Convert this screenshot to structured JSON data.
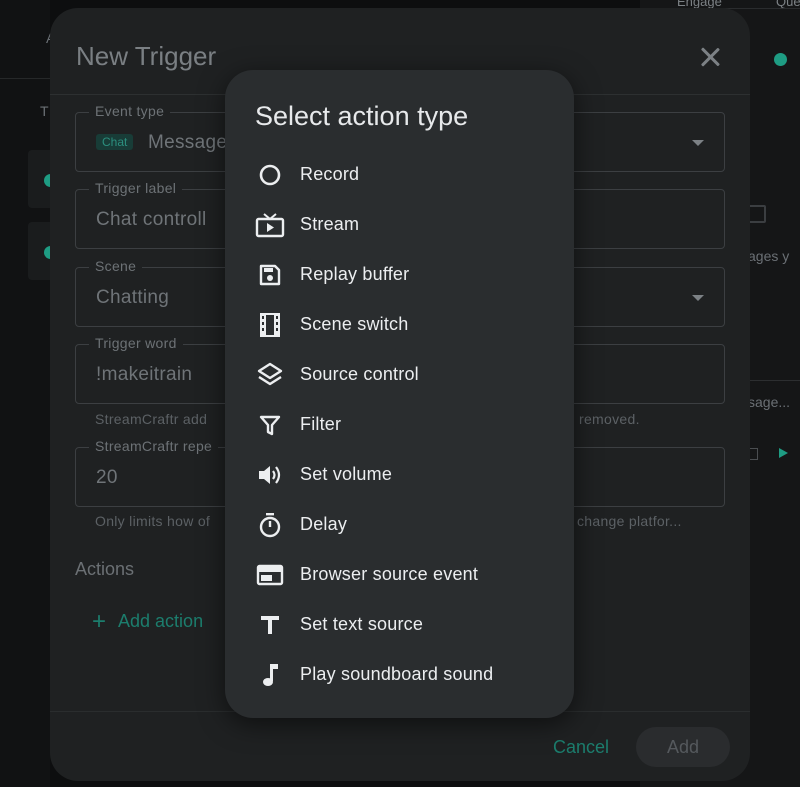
{
  "background": {
    "tabs": [
      "Engage",
      "Que"
    ],
    "left_fragments": [
      "A",
      "T"
    ],
    "right_fragments": [
      "ages y",
      "sage..."
    ]
  },
  "dialog": {
    "title": "New Trigger",
    "fields": {
      "event_type": {
        "label": "Event type",
        "chip": "Chat",
        "value": "Message"
      },
      "trigger_label": {
        "label": "Trigger label",
        "value": "Chat controll"
      },
      "scene": {
        "label": "Scene",
        "value": "Chatting"
      },
      "trigger_word": {
        "label": "Trigger word",
        "value": "!makeitrain"
      },
      "repeat": {
        "label": "StreamCraftr repe",
        "value": "20"
      }
    },
    "helper_trigger_word_left": "StreamCraftr add",
    "helper_trigger_word_right": "removed.",
    "helper_repeat_left": "Only limits how of",
    "helper_repeat_right": "change platfor...",
    "actions_heading": "Actions",
    "add_action_label": "Add action",
    "cancel_label": "Cancel",
    "add_label": "Add"
  },
  "popup": {
    "title": "Select action type",
    "items": [
      {
        "label": "Record",
        "icon": "record-icon"
      },
      {
        "label": "Stream",
        "icon": "tv-play-icon"
      },
      {
        "label": "Replay buffer",
        "icon": "save-icon"
      },
      {
        "label": "Scene switch",
        "icon": "film-icon"
      },
      {
        "label": "Source control",
        "icon": "layers-icon"
      },
      {
        "label": "Filter",
        "icon": "funnel-icon"
      },
      {
        "label": "Set volume",
        "icon": "volume-icon"
      },
      {
        "label": "Delay",
        "icon": "timer-icon"
      },
      {
        "label": "Browser source event",
        "icon": "browser-icon"
      },
      {
        "label": "Set text source",
        "icon": "text-icon"
      },
      {
        "label": "Play soundboard sound",
        "icon": "music-note-icon"
      }
    ]
  }
}
